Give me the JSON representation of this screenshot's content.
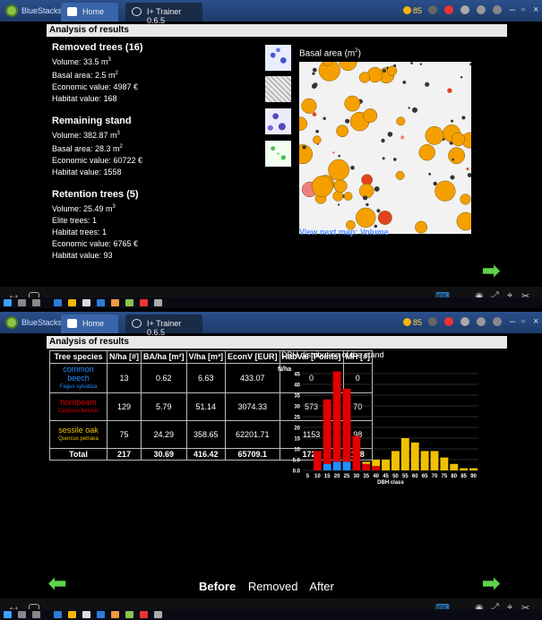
{
  "bluestacks": {
    "app_name": "BlueStacks",
    "tabs": [
      {
        "label": "Home"
      },
      {
        "label": "I+ Trainer 0.6.5"
      }
    ],
    "coins": "85"
  },
  "screen1": {
    "header": "Analysis of results",
    "removed": {
      "title": "Removed trees (16)",
      "volume": "Volume: 33.5 m",
      "basal": "Basal area: 2.5 m",
      "econ": "Economic value: 4987 €",
      "habitat": "Habitat value: 168"
    },
    "remaining": {
      "title": "Remaining stand",
      "volume": "Volume: 382.87 m",
      "basal": "Basal area: 28.3 m",
      "econ": "Economic value: 60722 €",
      "habitat": "Habitat value: 1558"
    },
    "retention": {
      "title": "Retention trees (5)",
      "volume": "Volume: 25.49 m",
      "elite": "Elite trees: 1",
      "habitat_trees": "Habitat trees: 1",
      "econ": "Economic value: 6765 €",
      "habitat": "Habitat value: 93"
    },
    "map_title": "Basal area (m",
    "map_title_end": ")",
    "next_map": "View next map: Volume",
    "sup3": "3",
    "sup2": "2"
  },
  "screen2": {
    "header": "Analysis of results",
    "table": {
      "headers": [
        "Tree species",
        "N/ha [#]",
        "BA/ha [m²]",
        "V/ha [m³]",
        "EconV [EUR]",
        "HabVal [Points]",
        "MH [#]"
      ],
      "rows": [
        {
          "species": "common beech",
          "latin": "Fagus sylvatica",
          "color": "#1e90ff",
          "n": "13",
          "ba": "0.62",
          "v": "6.63",
          "econv": "433.07",
          "habval": "0",
          "mh": "0"
        },
        {
          "species": "hornbeam",
          "latin": "Carpinus betulus",
          "color": "#e00000",
          "n": "129",
          "ba": "5.79",
          "v": "51.14",
          "econv": "3074.33",
          "habval": "573",
          "mh": "70"
        },
        {
          "species": "sessile oak",
          "latin": "Quercus petraea",
          "color": "#f0c000",
          "n": "75",
          "ba": "24.29",
          "v": "358.65",
          "econv": "62201.71",
          "habval": "1153",
          "mh": "98"
        }
      ],
      "total": {
        "label": "Total",
        "n": "217",
        "ba": "30.69",
        "v": "416.42",
        "econv": "65709.1",
        "habval": "1726",
        "mh": "168"
      }
    },
    "chart_title": "DBH distribution of the stand",
    "footer_tabs": [
      {
        "label": "Before",
        "active": true
      },
      {
        "label": "Removed",
        "active": false
      },
      {
        "label": "After",
        "active": false
      }
    ]
  },
  "chart_data": {
    "type": "bar",
    "ylabel": "N/ha",
    "xlabel": "DBH class",
    "ylim": [
      0,
      45
    ],
    "yticks": [
      "0.0",
      "5.0",
      "10",
      "15",
      "20",
      "25",
      "30",
      "35",
      "40",
      "45"
    ],
    "categories": [
      "5",
      "10",
      "15",
      "20",
      "25",
      "30",
      "35",
      "40",
      "45",
      "50",
      "55",
      "60",
      "65",
      "70",
      "75",
      "80",
      "85",
      "90"
    ],
    "series": [
      {
        "name": "common beech",
        "color": "#1e90ff",
        "values": [
          0,
          0,
          3,
          4,
          4,
          0,
          0,
          0,
          0,
          0,
          0,
          0,
          0,
          0,
          0,
          0,
          0,
          0
        ]
      },
      {
        "name": "hornbeam",
        "color": "#e00000",
        "values": [
          0,
          9,
          30,
          42,
          34,
          16,
          3,
          2,
          0,
          0,
          0,
          0,
          0,
          0,
          0,
          0,
          0,
          0
        ]
      },
      {
        "name": "sessile oak",
        "color": "#f0c000",
        "values": [
          0,
          0,
          0,
          0,
          0,
          0,
          1,
          3,
          5,
          9,
          15,
          13,
          9,
          9,
          6,
          3,
          1,
          1
        ]
      }
    ]
  }
}
